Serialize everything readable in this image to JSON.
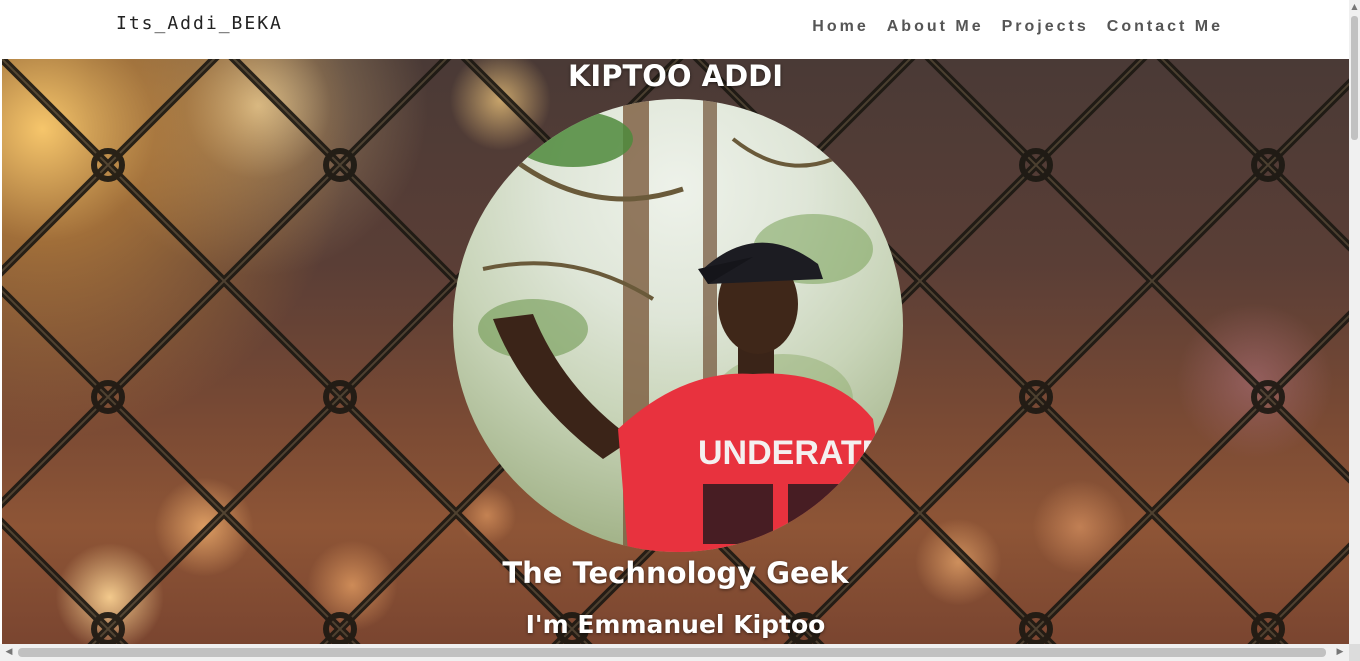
{
  "navbar": {
    "brand": "Its_Addi_BEKA",
    "links": [
      {
        "label": "Home"
      },
      {
        "label": "About Me"
      },
      {
        "label": "Projects"
      },
      {
        "label": "Contact Me"
      }
    ]
  },
  "hero": {
    "title": "KIPTOO ADDI",
    "profile_photo": "portrait-photo",
    "shirt_text": "UNDERATED",
    "subtitle": "The Technology Geek",
    "intro": "I'm Emmanuel Kiptoo",
    "background": "chain-link-fence-bokeh"
  },
  "scrollbars": {
    "vertical_arrow_up": "▲",
    "horizontal_arrow_left": "◀",
    "horizontal_arrow_right": "▶"
  },
  "colors": {
    "nav_text": "#555555",
    "hero_text": "#ffffff",
    "shirt_red": "#e8323e"
  }
}
